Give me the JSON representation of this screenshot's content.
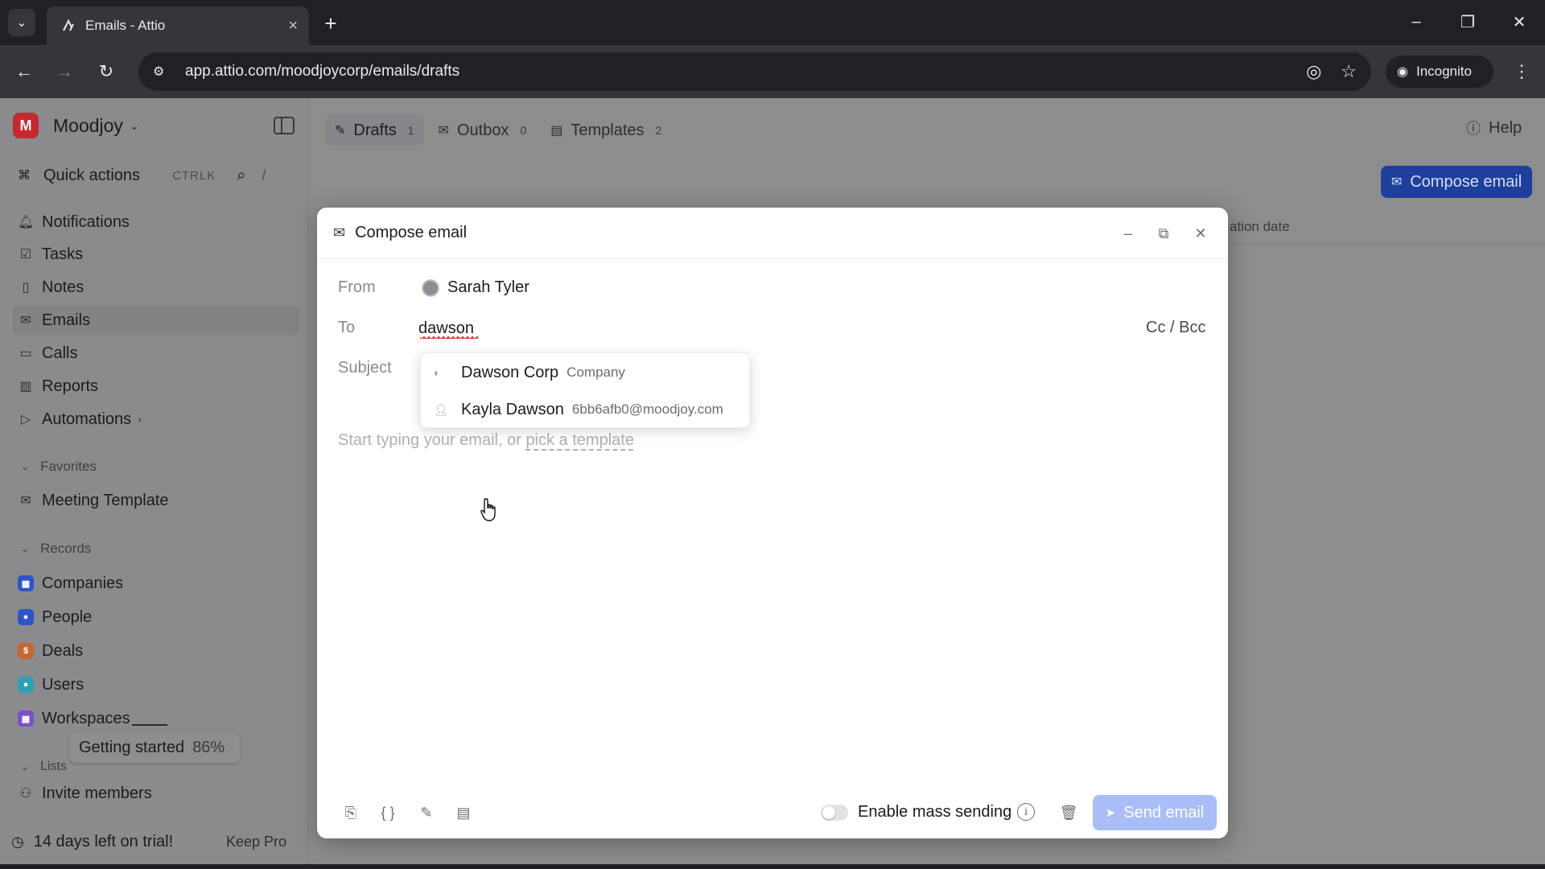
{
  "browser": {
    "tab_title": "Emails - Attio",
    "url": "app.attio.com/moodjoycorp/emails/drafts",
    "incognito_label": "Incognito"
  },
  "workspace": {
    "initial": "M",
    "name": "Moodjoy"
  },
  "sidebar": {
    "quick_actions": {
      "label": "Quick actions",
      "shortcut": "CTRLK",
      "slash": "/"
    },
    "nav": [
      {
        "label": "Notifications"
      },
      {
        "label": "Tasks"
      },
      {
        "label": "Notes"
      },
      {
        "label": "Emails"
      },
      {
        "label": "Calls"
      },
      {
        "label": "Reports"
      },
      {
        "label": "Automations"
      }
    ],
    "favorites_label": "Favorites",
    "favorites": [
      {
        "label": "Meeting Template"
      }
    ],
    "records_label": "Records",
    "records": [
      {
        "label": "Companies",
        "color": "#2f54c9"
      },
      {
        "label": "People",
        "color": "#2f54c9"
      },
      {
        "label": "Deals",
        "color": "#c9652f"
      },
      {
        "label": "Users",
        "color": "#2f9fb2"
      },
      {
        "label": "Workspaces",
        "color": "#7b4fc9"
      }
    ],
    "lists_label": "Lists",
    "getting_started": {
      "label": "Getting started",
      "percent": "86%"
    },
    "invite_label": "Invite members",
    "trial": {
      "label": "14 days left on trial!",
      "action": "Keep Pro"
    }
  },
  "top_tabs": [
    {
      "label": "Drafts",
      "count": "1"
    },
    {
      "label": "Outbox",
      "count": "0"
    },
    {
      "label": "Templates",
      "count": "2"
    }
  ],
  "help_label": "Help",
  "compose_button_label": "Compose email",
  "background_column_header": "ation date",
  "compose": {
    "title": "Compose email",
    "from_label": "From",
    "from_value": "Sarah Tyler",
    "to_label": "To",
    "to_value": "dawson",
    "cc_bcc": "Cc / Bcc",
    "subject_label": "Subject",
    "body_placeholder": "Start typing your email, or ",
    "body_link": "pick a template",
    "suggestions": [
      {
        "name": "Dawson Corp",
        "meta": "Company"
      },
      {
        "name": "Kayla Dawson",
        "meta": "6bb6afb0@moodjoy.com"
      }
    ],
    "mass_sending_label": "Enable mass sending",
    "mass_sending_enabled": false,
    "send_label": "Send email"
  },
  "colors": {
    "primary": "#1e3f9c",
    "send_disabled": "#a9bdf7",
    "workspace_avatar": "#c6282e"
  }
}
